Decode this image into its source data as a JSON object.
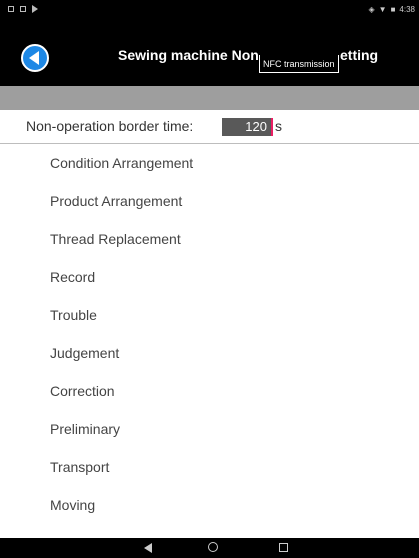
{
  "status_bar": {
    "time": "4:38",
    "left_icons": [
      "square-icon",
      "square-icon",
      "play-icon"
    ],
    "right_icons": [
      "wifi-icon",
      "signal-icon",
      "battery-icon"
    ]
  },
  "header": {
    "title_main": "Sewing machine Non",
    "tooltip": "NFC transmission",
    "title_tail": "etting",
    "back_icon": "back-arrow-icon"
  },
  "border_time": {
    "label": "Non-operation border time:",
    "value": "120",
    "unit": "s"
  },
  "menu": {
    "items": [
      {
        "label": "Condition Arrangement"
      },
      {
        "label": "Product Arrangement"
      },
      {
        "label": "Thread Replacement"
      },
      {
        "label": "Record"
      },
      {
        "label": "Trouble"
      },
      {
        "label": "Judgement"
      },
      {
        "label": "Correction"
      },
      {
        "label": "Preliminary"
      },
      {
        "label": "Transport"
      },
      {
        "label": "Moving"
      }
    ]
  },
  "nav_bar": {
    "icons": [
      "nav-back-icon",
      "nav-home-icon",
      "nav-recent-icon"
    ]
  },
  "colors": {
    "accent": "#1e88e5",
    "header_bg": "#000000",
    "band": "#9e9e9e",
    "cursor": "#e91e63"
  }
}
